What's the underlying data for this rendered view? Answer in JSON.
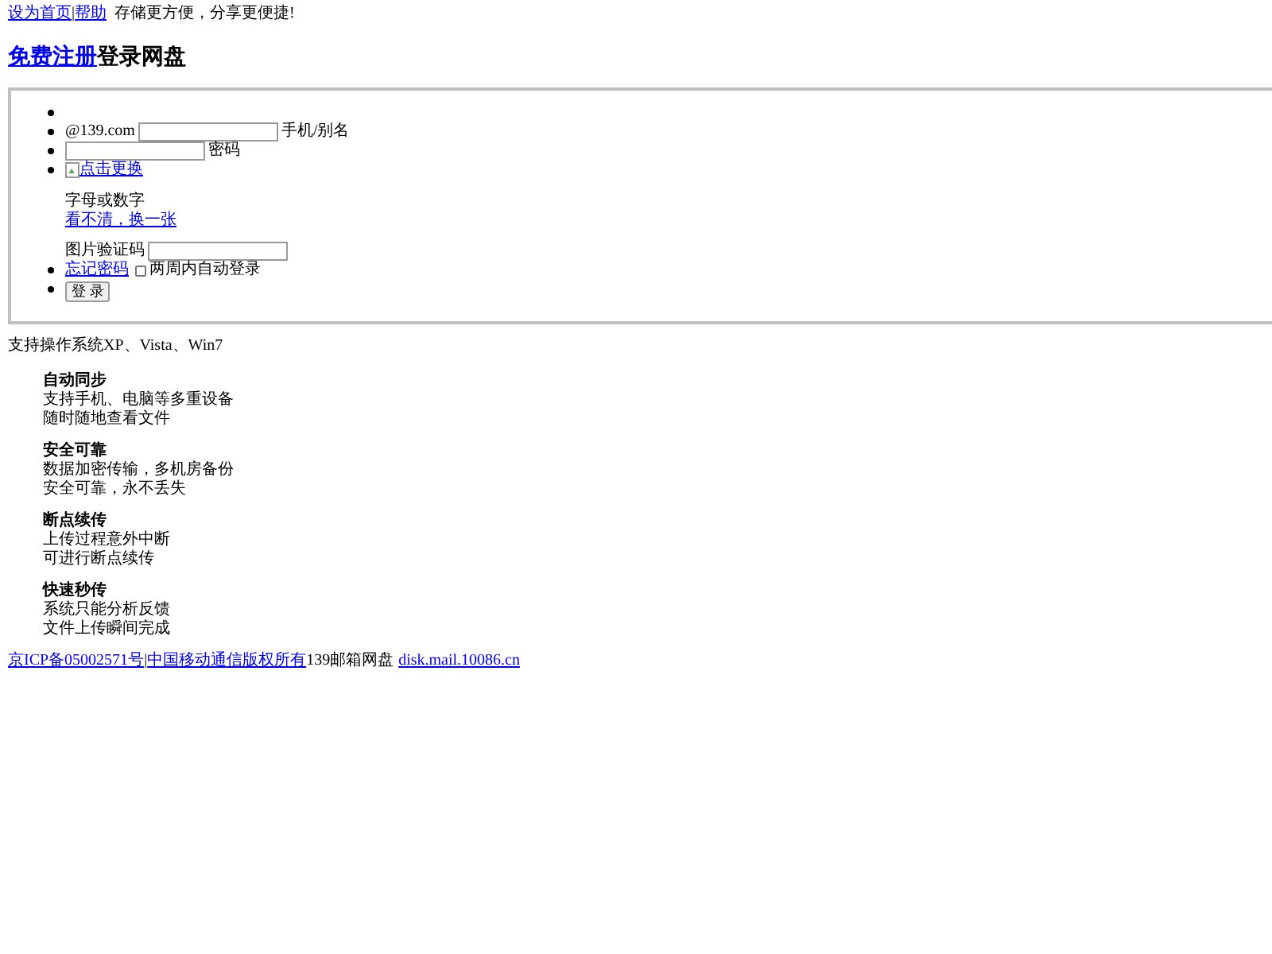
{
  "top_bar": {
    "links": [
      "设为首页",
      "帮助"
    ],
    "separator": "|",
    "slogan": "存储更方便，分享更便捷!"
  },
  "heading": {
    "link": "免费注册",
    "text": "登录网盘"
  },
  "form": {
    "account": {
      "prefix": "@139.com",
      "label": "手机/别名"
    },
    "password": {
      "label": "密码"
    },
    "captcha": {
      "image_link": "点击更换",
      "hint": "字母或数字",
      "refresh_link": "看不清，换一张",
      "label": "图片验证码"
    },
    "forgot_link": "忘记密码",
    "remember": {
      "label": "两周内自动登录",
      "checked": false
    },
    "submit": "登 录"
  },
  "os_note": "支持操作系统XP、Vista、Win7",
  "features": [
    {
      "title": "自动同步",
      "lines": [
        "支持手机、电脑等多重设备",
        "随时随地查看文件"
      ]
    },
    {
      "title": "安全可靠",
      "lines": [
        "数据加密传输，多机房备份",
        "安全可靠，永不丢失"
      ]
    },
    {
      "title": "断点续传",
      "lines": [
        "上传过程意外中断",
        "可进行断点续传"
      ]
    },
    {
      "title": "快速秒传",
      "lines": [
        "系统只能分析反馈",
        "文件上传瞬间完成"
      ]
    }
  ],
  "footer": {
    "links": [
      "京ICP备05002571号",
      "中国移动通信版权所有"
    ],
    "separator": "|",
    "text": "139邮箱网盘",
    "url": "disk.mail.10086.cn"
  }
}
